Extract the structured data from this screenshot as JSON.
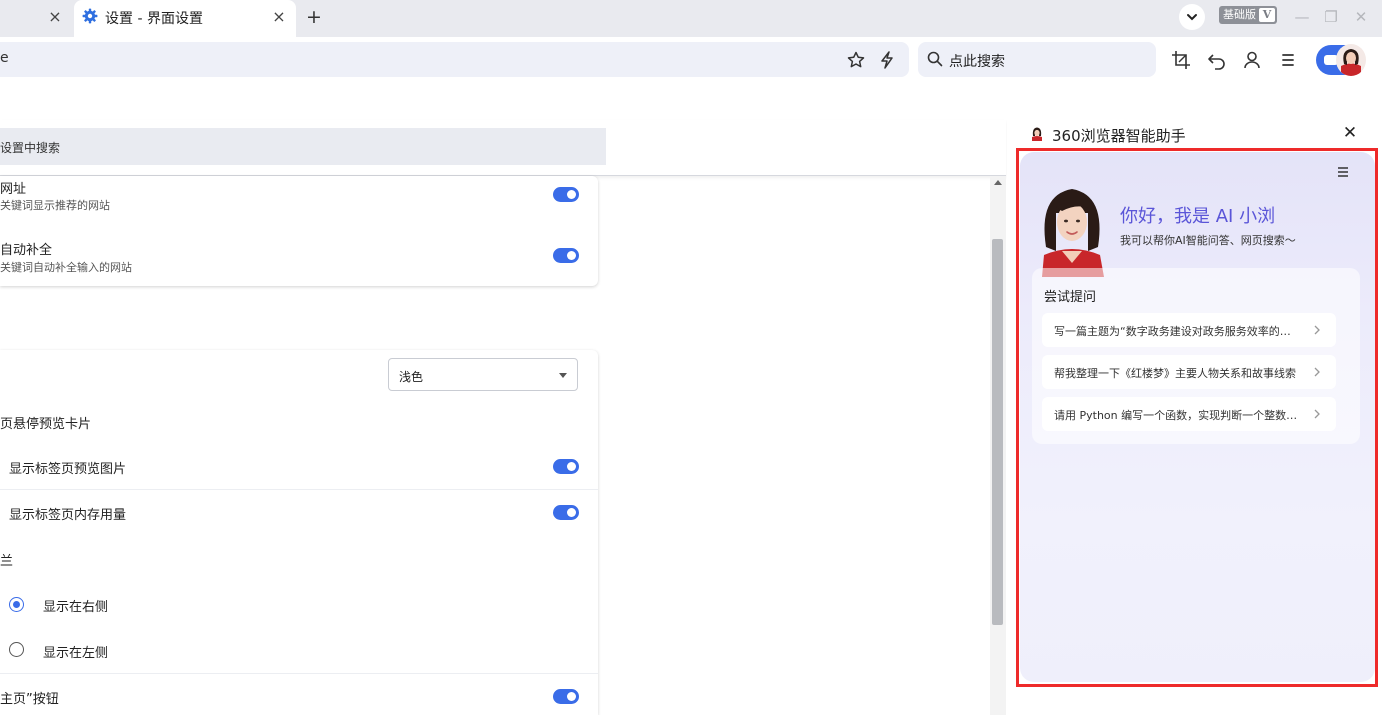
{
  "tabs": {
    "active_title": "设置 - 界面设置",
    "close_glyph": "×",
    "new_tab_glyph": "+"
  },
  "window": {
    "edition_label": "基础版",
    "edition_mark": "V",
    "minimize_glyph": "—",
    "restore_glyph": "❐",
    "close_glyph": "✕"
  },
  "toolbar": {
    "url_text": "e",
    "search_placeholder": "点此搜索"
  },
  "settings": {
    "search_placeholder": "设置中搜索",
    "card1": {
      "rows": [
        {
          "title": "网址",
          "sub": "关键词显示推荐的网站",
          "enabled": true
        },
        {
          "title": "自动补全",
          "sub": "关键词自动补全输入的网站",
          "enabled": true
        }
      ]
    },
    "card2": {
      "theme_value": "浅色",
      "hover_preview_title": "页悬停预览卡片",
      "hover_options": [
        {
          "label": "显示标签页预览图片",
          "enabled": true
        },
        {
          "label": "显示标签页内存用量",
          "enabled": true
        }
      ],
      "sidebar_group_title": "兰",
      "sidebar_position": [
        {
          "label": "显示在右侧",
          "selected": true
        },
        {
          "label": "显示在左侧",
          "selected": false
        }
      ],
      "home_button_title": "主页”按钮",
      "home_button_enabled": true
    }
  },
  "assistant": {
    "title": "360浏览器智能助手",
    "close_glyph": "✕",
    "greeting": "你好，我是 AI 小浏",
    "greeting_sub": "我可以帮你AI智能问答、网页搜索〜",
    "try_title": "尝试提问",
    "prompts": [
      "写一篇主题为“数字政务建设对政务服务效率的…",
      "帮我整理一下《红楼梦》主要人物关系和故事线索",
      "请用 Python 编写一个函数，实现判断一个整数…"
    ]
  },
  "colors": {
    "accent": "#3a6ce8",
    "highlight_frame": "#ee2a2a",
    "tabstrip_bg": "#e9eaef"
  }
}
